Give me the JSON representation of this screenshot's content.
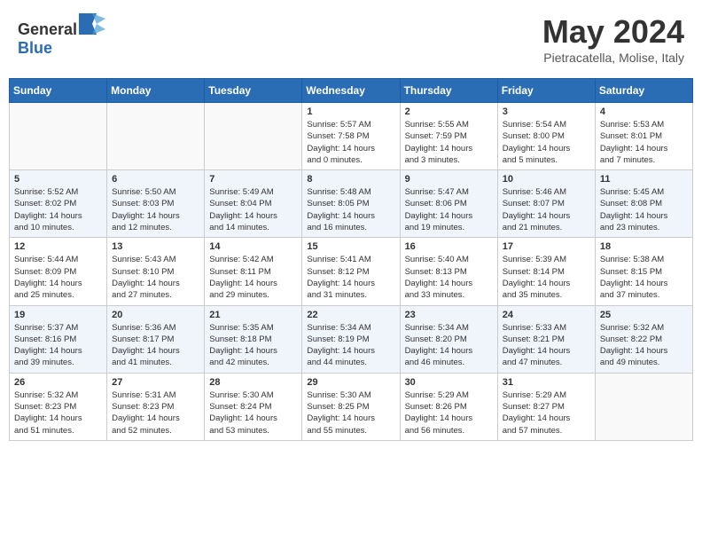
{
  "header": {
    "logo": {
      "general": "General",
      "blue": "Blue"
    },
    "month": "May 2024",
    "location": "Pietracatella, Molise, Italy"
  },
  "weekdays": [
    "Sunday",
    "Monday",
    "Tuesday",
    "Wednesday",
    "Thursday",
    "Friday",
    "Saturday"
  ],
  "weeks": [
    [
      {
        "day": "",
        "info": ""
      },
      {
        "day": "",
        "info": ""
      },
      {
        "day": "",
        "info": ""
      },
      {
        "day": "1",
        "info": "Sunrise: 5:57 AM\nSunset: 7:58 PM\nDaylight: 14 hours\nand 0 minutes."
      },
      {
        "day": "2",
        "info": "Sunrise: 5:55 AM\nSunset: 7:59 PM\nDaylight: 14 hours\nand 3 minutes."
      },
      {
        "day": "3",
        "info": "Sunrise: 5:54 AM\nSunset: 8:00 PM\nDaylight: 14 hours\nand 5 minutes."
      },
      {
        "day": "4",
        "info": "Sunrise: 5:53 AM\nSunset: 8:01 PM\nDaylight: 14 hours\nand 7 minutes."
      }
    ],
    [
      {
        "day": "5",
        "info": "Sunrise: 5:52 AM\nSunset: 8:02 PM\nDaylight: 14 hours\nand 10 minutes."
      },
      {
        "day": "6",
        "info": "Sunrise: 5:50 AM\nSunset: 8:03 PM\nDaylight: 14 hours\nand 12 minutes."
      },
      {
        "day": "7",
        "info": "Sunrise: 5:49 AM\nSunset: 8:04 PM\nDaylight: 14 hours\nand 14 minutes."
      },
      {
        "day": "8",
        "info": "Sunrise: 5:48 AM\nSunset: 8:05 PM\nDaylight: 14 hours\nand 16 minutes."
      },
      {
        "day": "9",
        "info": "Sunrise: 5:47 AM\nSunset: 8:06 PM\nDaylight: 14 hours\nand 19 minutes."
      },
      {
        "day": "10",
        "info": "Sunrise: 5:46 AM\nSunset: 8:07 PM\nDaylight: 14 hours\nand 21 minutes."
      },
      {
        "day": "11",
        "info": "Sunrise: 5:45 AM\nSunset: 8:08 PM\nDaylight: 14 hours\nand 23 minutes."
      }
    ],
    [
      {
        "day": "12",
        "info": "Sunrise: 5:44 AM\nSunset: 8:09 PM\nDaylight: 14 hours\nand 25 minutes."
      },
      {
        "day": "13",
        "info": "Sunrise: 5:43 AM\nSunset: 8:10 PM\nDaylight: 14 hours\nand 27 minutes."
      },
      {
        "day": "14",
        "info": "Sunrise: 5:42 AM\nSunset: 8:11 PM\nDaylight: 14 hours\nand 29 minutes."
      },
      {
        "day": "15",
        "info": "Sunrise: 5:41 AM\nSunset: 8:12 PM\nDaylight: 14 hours\nand 31 minutes."
      },
      {
        "day": "16",
        "info": "Sunrise: 5:40 AM\nSunset: 8:13 PM\nDaylight: 14 hours\nand 33 minutes."
      },
      {
        "day": "17",
        "info": "Sunrise: 5:39 AM\nSunset: 8:14 PM\nDaylight: 14 hours\nand 35 minutes."
      },
      {
        "day": "18",
        "info": "Sunrise: 5:38 AM\nSunset: 8:15 PM\nDaylight: 14 hours\nand 37 minutes."
      }
    ],
    [
      {
        "day": "19",
        "info": "Sunrise: 5:37 AM\nSunset: 8:16 PM\nDaylight: 14 hours\nand 39 minutes."
      },
      {
        "day": "20",
        "info": "Sunrise: 5:36 AM\nSunset: 8:17 PM\nDaylight: 14 hours\nand 41 minutes."
      },
      {
        "day": "21",
        "info": "Sunrise: 5:35 AM\nSunset: 8:18 PM\nDaylight: 14 hours\nand 42 minutes."
      },
      {
        "day": "22",
        "info": "Sunrise: 5:34 AM\nSunset: 8:19 PM\nDaylight: 14 hours\nand 44 minutes."
      },
      {
        "day": "23",
        "info": "Sunrise: 5:34 AM\nSunset: 8:20 PM\nDaylight: 14 hours\nand 46 minutes."
      },
      {
        "day": "24",
        "info": "Sunrise: 5:33 AM\nSunset: 8:21 PM\nDaylight: 14 hours\nand 47 minutes."
      },
      {
        "day": "25",
        "info": "Sunrise: 5:32 AM\nSunset: 8:22 PM\nDaylight: 14 hours\nand 49 minutes."
      }
    ],
    [
      {
        "day": "26",
        "info": "Sunrise: 5:32 AM\nSunset: 8:23 PM\nDaylight: 14 hours\nand 51 minutes."
      },
      {
        "day": "27",
        "info": "Sunrise: 5:31 AM\nSunset: 8:23 PM\nDaylight: 14 hours\nand 52 minutes."
      },
      {
        "day": "28",
        "info": "Sunrise: 5:30 AM\nSunset: 8:24 PM\nDaylight: 14 hours\nand 53 minutes."
      },
      {
        "day": "29",
        "info": "Sunrise: 5:30 AM\nSunset: 8:25 PM\nDaylight: 14 hours\nand 55 minutes."
      },
      {
        "day": "30",
        "info": "Sunrise: 5:29 AM\nSunset: 8:26 PM\nDaylight: 14 hours\nand 56 minutes."
      },
      {
        "day": "31",
        "info": "Sunrise: 5:29 AM\nSunset: 8:27 PM\nDaylight: 14 hours\nand 57 minutes."
      },
      {
        "day": "",
        "info": ""
      }
    ]
  ]
}
